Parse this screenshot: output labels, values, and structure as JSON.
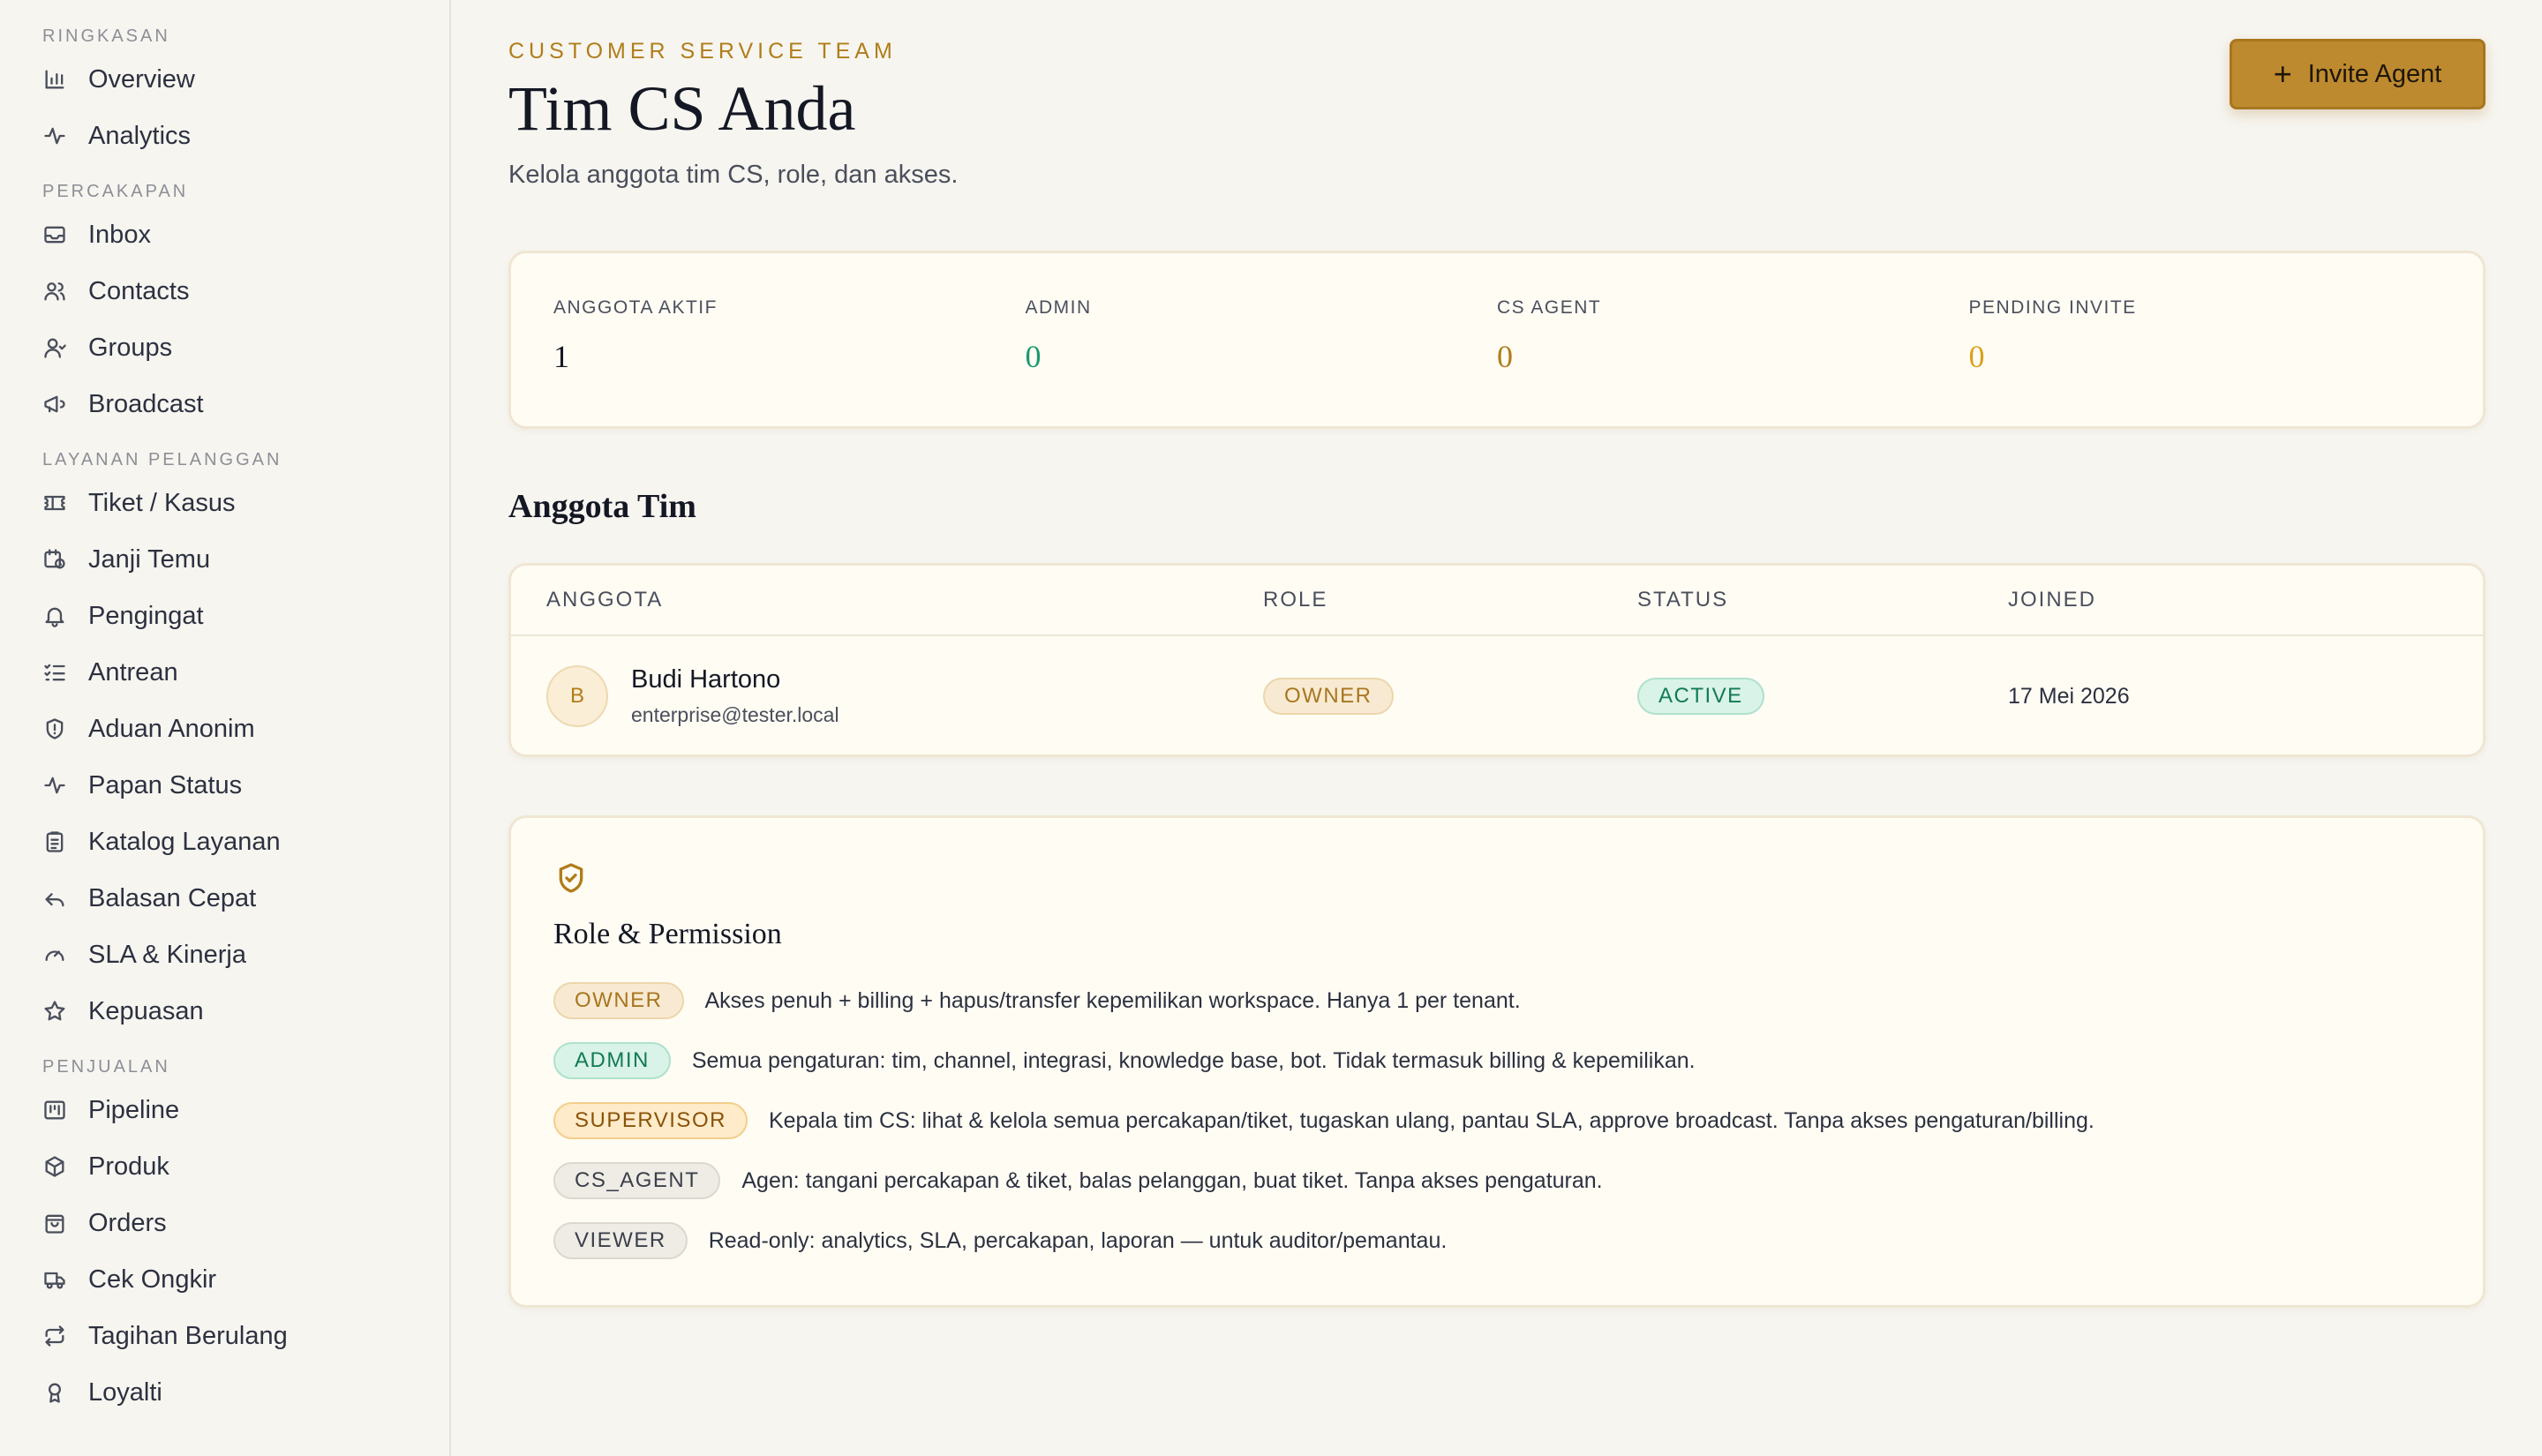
{
  "sidebar": {
    "sections": [
      {
        "label": "RINGKASAN",
        "items": [
          {
            "label": "Overview",
            "icon": "bar-chart-icon"
          },
          {
            "label": "Analytics",
            "icon": "activity-icon"
          }
        ]
      },
      {
        "label": "PERCAKAPAN",
        "items": [
          {
            "label": "Inbox",
            "icon": "inbox-icon"
          },
          {
            "label": "Contacts",
            "icon": "users-icon"
          },
          {
            "label": "Groups",
            "icon": "group-icon"
          },
          {
            "label": "Broadcast",
            "icon": "megaphone-icon"
          }
        ]
      },
      {
        "label": "LAYANAN PELANGGAN",
        "items": [
          {
            "label": "Tiket / Kasus",
            "icon": "ticket-icon"
          },
          {
            "label": "Janji Temu",
            "icon": "calendar-clock-icon"
          },
          {
            "label": "Pengingat",
            "icon": "bell-icon"
          },
          {
            "label": "Antrean",
            "icon": "list-check-icon"
          },
          {
            "label": "Aduan Anonim",
            "icon": "shield-icon"
          },
          {
            "label": "Papan Status",
            "icon": "pulse-icon"
          },
          {
            "label": "Katalog Layanan",
            "icon": "clipboard-icon"
          },
          {
            "label": "Balasan Cepat",
            "icon": "reply-icon"
          },
          {
            "label": "SLA & Kinerja",
            "icon": "gauge-icon"
          },
          {
            "label": "Kepuasan",
            "icon": "star-icon"
          }
        ]
      },
      {
        "label": "PENJUALAN",
        "items": [
          {
            "label": "Pipeline",
            "icon": "kanban-icon"
          },
          {
            "label": "Produk",
            "icon": "package-icon"
          },
          {
            "label": "Orders",
            "icon": "shopping-bag-icon"
          },
          {
            "label": "Cek Ongkir",
            "icon": "truck-icon"
          },
          {
            "label": "Tagihan Berulang",
            "icon": "repeat-icon"
          },
          {
            "label": "Loyalti",
            "icon": "award-icon"
          }
        ]
      }
    ]
  },
  "header": {
    "eyebrow": "CUSTOMER SERVICE TEAM",
    "title": "Tim CS Anda",
    "subtitle": "Kelola anggota tim CS, role, dan akses.",
    "invite_label": "Invite Agent"
  },
  "stats": [
    {
      "label": "ANGGOTA AKTIF",
      "value": "1",
      "color": "#141824"
    },
    {
      "label": "ADMIN",
      "value": "0",
      "color": "#1a9a6e"
    },
    {
      "label": "CS AGENT",
      "value": "0",
      "color": "#b07d1a"
    },
    {
      "label": "PENDING INVITE",
      "value": "0",
      "color": "#d9a21b"
    }
  ],
  "members_title": "Anggota Tim",
  "table": {
    "headers": {
      "member": "ANGGOTA",
      "role": "ROLE",
      "status": "STATUS",
      "joined": "JOINED"
    },
    "rows": [
      {
        "initial": "B",
        "name": "Budi Hartono",
        "email": "enterprise@tester.local",
        "role": "OWNER",
        "status": "ACTIVE",
        "joined": "17 Mei 2026"
      }
    ]
  },
  "permissions": {
    "title": "Role & Permission",
    "roles": [
      {
        "badge": "OWNER",
        "style": "owner",
        "desc": "Akses penuh + billing + hapus/transfer kepemilikan workspace. Hanya 1 per tenant."
      },
      {
        "badge": "ADMIN",
        "style": "admin",
        "desc": "Semua pengaturan: tim, channel, integrasi, knowledge base, bot. Tidak termasuk billing & kepemilikan."
      },
      {
        "badge": "SUPERVISOR",
        "style": "super",
        "desc": "Kepala tim CS: lihat & kelola semua percakapan/tiket, tugaskan ulang, pantau SLA, approve broadcast. Tanpa akses pengaturan/billing."
      },
      {
        "badge": "CS_AGENT",
        "style": "agent",
        "desc": "Agen: tangani percakapan & tiket, balas pelanggan, buat tiket. Tanpa akses pengaturan."
      },
      {
        "badge": "VIEWER",
        "style": "viewer",
        "desc": "Read-only: analytics, SLA, percakapan, laporan — untuk auditor/pemantau."
      }
    ]
  }
}
